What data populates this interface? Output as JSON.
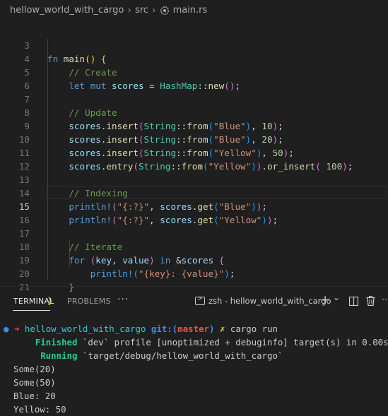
{
  "breadcrumb": {
    "folder": "hellow_world_with_cargo",
    "subfolder": "src",
    "file": "main.rs",
    "file_icon": "rust-file-icon"
  },
  "editor": {
    "current_line": "15",
    "lines": [
      {
        "n": "3"
      },
      {
        "n": "4"
      },
      {
        "n": "5"
      },
      {
        "n": "6"
      },
      {
        "n": "7"
      },
      {
        "n": "8"
      },
      {
        "n": "9"
      },
      {
        "n": "10"
      },
      {
        "n": "11"
      },
      {
        "n": "12"
      },
      {
        "n": "13"
      },
      {
        "n": "14"
      },
      {
        "n": "15"
      },
      {
        "n": "16"
      },
      {
        "n": "17"
      },
      {
        "n": "18"
      },
      {
        "n": "19"
      },
      {
        "n": "20"
      },
      {
        "n": "21"
      }
    ],
    "t": {
      "fn": "fn",
      "main": "main",
      "paren_open": "(",
      "paren_close": ")",
      "brace_open": "{",
      "brace_close": "}",
      "c_create": "// Create",
      "let": "let",
      "mut": "mut",
      "scores": "scores",
      "eq": " = ",
      "HashMap": "HashMap",
      "dc": "::",
      "new": "new",
      "semi": ";",
      "c_update": "// Update",
      "dot": ".",
      "insert": "insert",
      "String": "String",
      "from": "from",
      "blue": "\"Blue\"",
      "yellow": "\"Yellow\"",
      "comma": ", ",
      "n10": "10",
      "n20": "20",
      "n50": "50",
      "entry": "entry",
      "or_insert": "or_insert",
      "n100": "100",
      "c_index": "// Indexing",
      "println": "println!",
      "fmt": "\"{:?}\"",
      "get": "get",
      "c_iter": "// Iterate",
      "for": "for",
      "key": "key",
      "value": "value",
      "in": "in",
      "amp": "&",
      "fmt2": "\"{key}: {value}\""
    }
  },
  "panel": {
    "tabs": [
      "TERMINAL",
      "PROBLEMS"
    ],
    "active_tab": "TERMINAL",
    "more": "···",
    "terminal_name": "zsh - hellow_world_with_cargo",
    "add": "+",
    "chevron": "⌄"
  },
  "terminal": {
    "prompt_dot": "●",
    "prompt_arrow": "➜",
    "prompt_path": "hellow_world_with_cargo",
    "git_label": "git:(",
    "branch": "master",
    "git_close": ")",
    "xmark": "✗",
    "command": "cargo run",
    "finished_word": "Finished",
    "finished_rest": " `dev` profile [unoptimized + debuginfo] target(s) in 0.00s",
    "running_word": "Running",
    "running_rest": " `target/debug/hellow_world_with_cargo`",
    "output": [
      "Some(20)",
      "Some(50)",
      "Blue: 20",
      "Yellow: 50"
    ]
  },
  "colors": {
    "background": "#1f1f1f",
    "keyword": "#569cd6",
    "string": "#ce9178",
    "type": "#4ec9b0",
    "function": "#dcdcaa",
    "comment": "#6a9955",
    "number": "#b5cea8"
  }
}
